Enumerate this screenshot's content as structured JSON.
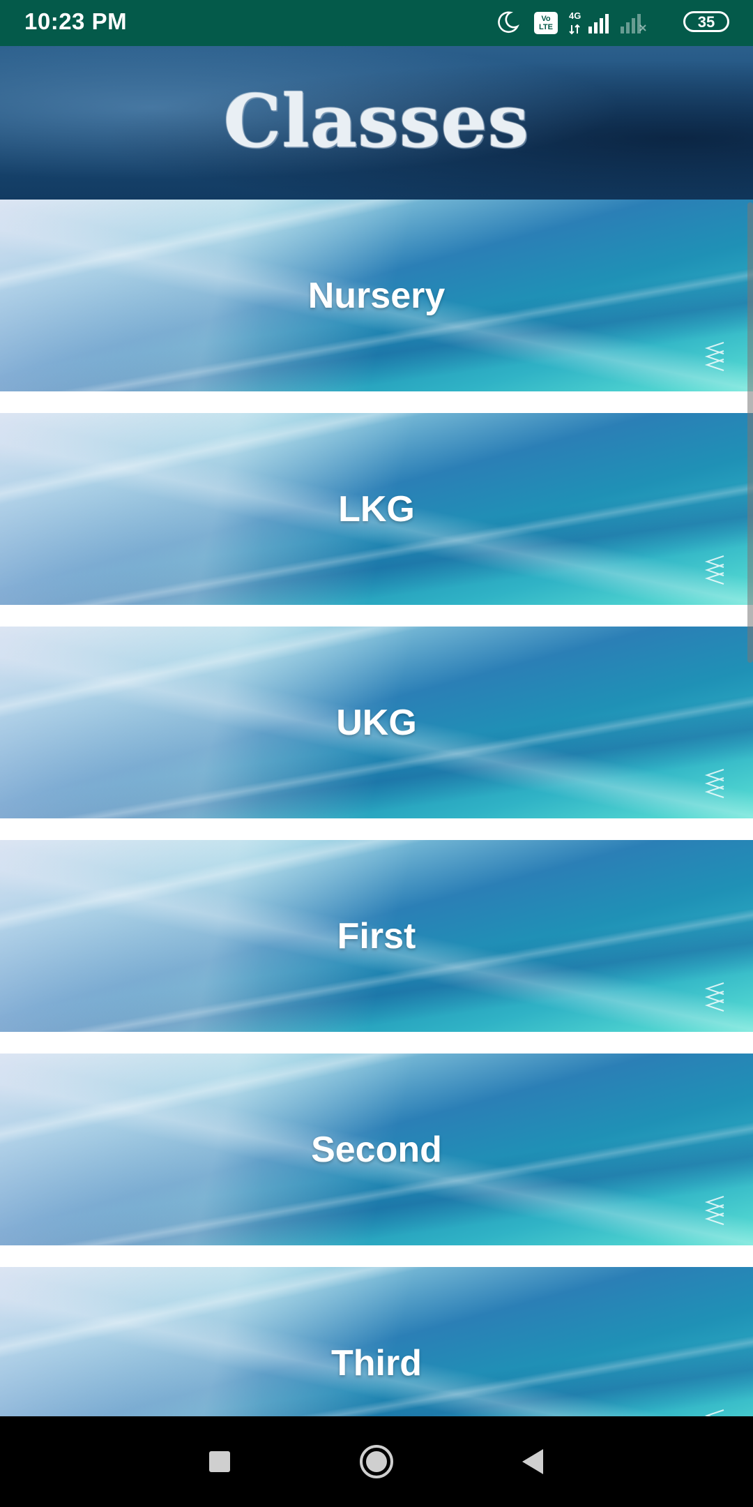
{
  "status_bar": {
    "time": "10:23 PM",
    "volte_label": "Vo LTE",
    "network_label": "4G",
    "battery": "35",
    "icons": [
      "moon-icon",
      "volte-icon",
      "signal-4g-icon",
      "signal-no-service-icon",
      "battery-icon"
    ]
  },
  "header": {
    "title": "Classes"
  },
  "classes": [
    {
      "label": "Nursery"
    },
    {
      "label": "LKG"
    },
    {
      "label": "UKG"
    },
    {
      "label": "First"
    },
    {
      "label": "Second"
    },
    {
      "label": "Third"
    }
  ],
  "nav_bar": {
    "icons": [
      "recents-square-icon",
      "home-circle-icon",
      "back-triangle-icon"
    ]
  },
  "colors": {
    "status_bar_bg": "#045a4a",
    "header_bg": "#1c4c78",
    "card_accent_teal": "#5de3d5",
    "card_accent_blue": "#2b7fb6"
  }
}
